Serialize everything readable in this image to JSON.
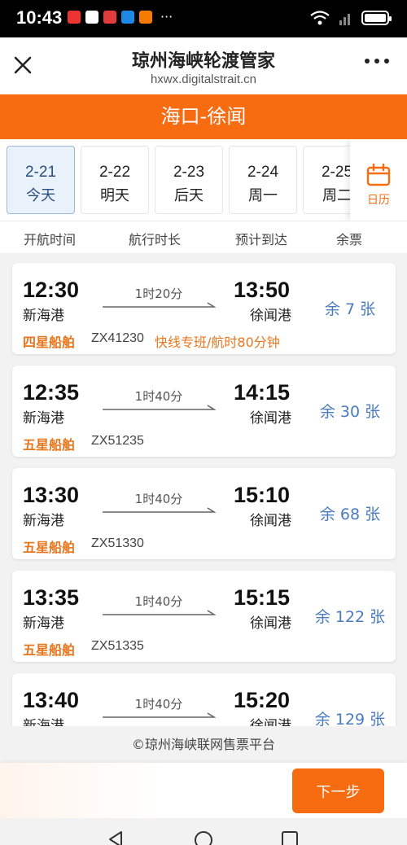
{
  "status_bar": {
    "time": "10:43"
  },
  "header": {
    "title": "琼州海峡轮渡管家",
    "url": "hxwx.digitalstrait.cn"
  },
  "route_title": "海口-徐闻",
  "dates": [
    {
      "date": "2-21",
      "label": "今天",
      "selected": true
    },
    {
      "date": "2-22",
      "label": "明天"
    },
    {
      "date": "2-23",
      "label": "后天"
    },
    {
      "date": "2-24",
      "label": "周一"
    },
    {
      "date": "2-25",
      "label": "周二"
    }
  ],
  "calendar_label": "日历",
  "columns": [
    "开航时间",
    "航行时长",
    "预计到达",
    "余票"
  ],
  "sailings": [
    {
      "depart_time": "12:30",
      "depart_port": "新海港",
      "duration": "1时20分",
      "arrive_time": "13:50",
      "arrive_port": "徐闻港",
      "remaining": "余 7 张",
      "ship_class": "四星船舶",
      "code": "ZX41230",
      "note": "快线专班/航时80分钟"
    },
    {
      "depart_time": "12:35",
      "depart_port": "新海港",
      "duration": "1时40分",
      "arrive_time": "14:15",
      "arrive_port": "徐闻港",
      "remaining": "余 30 张",
      "ship_class": "五星船舶",
      "code": "ZX51235",
      "note": ""
    },
    {
      "depart_time": "13:30",
      "depart_port": "新海港",
      "duration": "1时40分",
      "arrive_time": "15:10",
      "arrive_port": "徐闻港",
      "remaining": "余 68 张",
      "ship_class": "五星船舶",
      "code": "ZX51330",
      "note": ""
    },
    {
      "depart_time": "13:35",
      "depart_port": "新海港",
      "duration": "1时40分",
      "arrive_time": "15:15",
      "arrive_port": "徐闻港",
      "remaining": "余 122 张",
      "ship_class": "五星船舶",
      "code": "ZX51335",
      "note": ""
    },
    {
      "depart_time": "13:40",
      "depart_port": "新海港",
      "duration": "1时40分",
      "arrive_time": "15:20",
      "arrive_port": "徐闻港",
      "remaining": "余 129 张",
      "ship_class": "",
      "code": "",
      "note": ""
    }
  ],
  "footer": {
    "copyright": "©琼州海峡联网售票平台",
    "next_button": "下一步"
  },
  "colors": {
    "accent": "#f76b11",
    "ticket_blue": "#4b7bbf",
    "ship_orange": "#e8761d"
  }
}
